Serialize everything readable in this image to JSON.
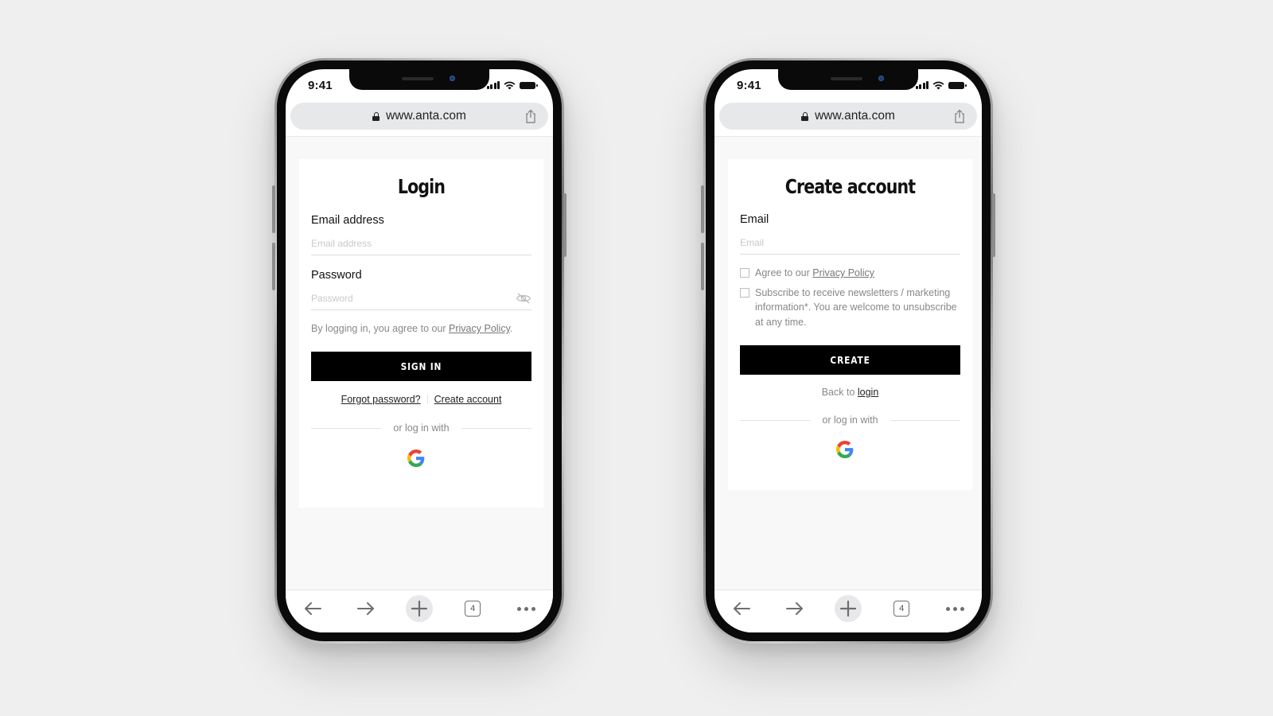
{
  "phones": [
    {
      "status": {
        "time": "9:41"
      },
      "browser": {
        "url": "www.anta.com",
        "tab_count": "4"
      },
      "login": {
        "title": "Login",
        "email_label": "Email address",
        "email_placeholder": "Email address",
        "password_label": "Password",
        "password_placeholder": "Password",
        "terms_prefix": "By logging in, you agree to our ",
        "terms_link": "Privacy Policy",
        "terms_suffix": ".",
        "sign_in_label": "SIGN IN",
        "forgot_password_label": "Forgot password?",
        "create_account_label": "Create account",
        "social_divider": "or log in with",
        "social_provider": "google-icon"
      }
    },
    {
      "status": {
        "time": "9:41"
      },
      "browser": {
        "url": "www.anta.com",
        "tab_count": "4"
      },
      "register": {
        "title": "Create account",
        "email_label": "Email",
        "email_placeholder": "Email",
        "agree_prefix": "Agree to our ",
        "agree_link": "Privacy Policy",
        "subscribe_text": "Subscribe to receive newsletters / marketing information*. You are welcome to unsubscribe at any time.",
        "create_label": "CREATE",
        "back_prefix": "Back to ",
        "back_link": "login",
        "social_divider": "or log in with",
        "social_provider": "google-icon"
      }
    }
  ],
  "colors": {
    "background": "#efefef",
    "button_bg": "#000000",
    "button_text": "#ffffff",
    "muted_text": "#888888"
  }
}
